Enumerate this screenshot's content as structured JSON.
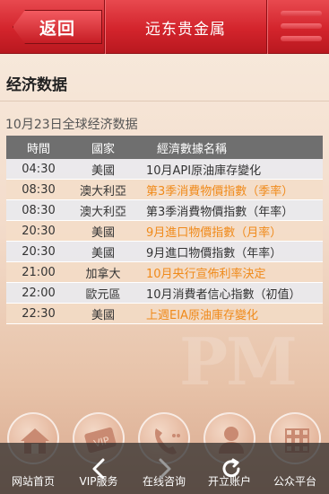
{
  "header": {
    "back_label": "返回",
    "title": "远东贵金属"
  },
  "section_title": "经济数据",
  "date_line": "10月23日全球经济数据",
  "table": {
    "headers": [
      "時間",
      "國家",
      "經濟數據名稱"
    ],
    "rows": [
      {
        "time": "04:30",
        "country": "美國",
        "event": "10月API原油庫存變化"
      },
      {
        "time": "08:30",
        "country": "澳大利亞",
        "event": "第3季消費物價指數（季率）"
      },
      {
        "time": "08:30",
        "country": "澳大利亞",
        "event": "第3季消費物價指數（年率）"
      },
      {
        "time": "20:30",
        "country": "美國",
        "event": "9月進口物價指數（月率）"
      },
      {
        "time": "20:30",
        "country": "美國",
        "event": "9月進口物價指數（年率）"
      },
      {
        "time": "21:00",
        "country": "加拿大",
        "event": "10月央行宣佈利率決定"
      },
      {
        "time": "22:00",
        "country": "歐元區",
        "event": "10月消費者信心指數（初值）"
      },
      {
        "time": "22:30",
        "country": "美國",
        "event": "上週EIA原油庫存變化"
      }
    ]
  },
  "watermark": "PM",
  "bottom_nav": [
    {
      "label": "网站首页",
      "icon": "home-icon"
    },
    {
      "label": "VIP服务",
      "icon": "vip-icon"
    },
    {
      "label": "在线咨询",
      "icon": "phone-icon"
    },
    {
      "label": "开立账户",
      "icon": "user-icon"
    },
    {
      "label": "公众平台",
      "icon": "grid-icon"
    }
  ],
  "browser_bar": {
    "buttons": [
      "back-arrow-icon",
      "forward-arrow-icon",
      "refresh-icon"
    ]
  },
  "colors": {
    "header_red": "#d3242c",
    "highlight_orange": "#f08a1a",
    "table_header": "#6f6f6f"
  }
}
